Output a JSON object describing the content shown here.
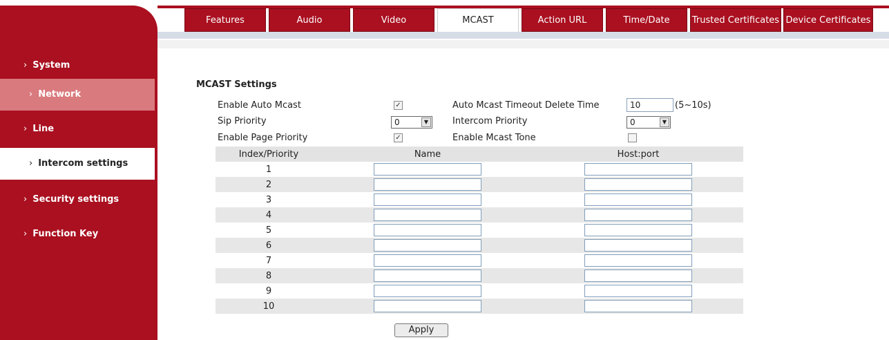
{
  "sidebar": {
    "items": [
      {
        "label": "System"
      },
      {
        "label": "Network"
      },
      {
        "label": "Line"
      },
      {
        "label": "Intercom settings"
      },
      {
        "label": "Security settings"
      },
      {
        "label": "Function Key"
      }
    ],
    "chevron": "›"
  },
  "tabs": [
    {
      "label": "Features"
    },
    {
      "label": "Audio"
    },
    {
      "label": "Video"
    },
    {
      "label": "MCAST"
    },
    {
      "label": "Action URL"
    },
    {
      "label": "Time/Date"
    },
    {
      "label": "Trusted Certificates"
    },
    {
      "label": "Device Certificates"
    }
  ],
  "mcast": {
    "title": "MCAST Settings",
    "enable_auto_mcast": {
      "label": "Enable Auto Mcast",
      "checked": true
    },
    "auto_timeout": {
      "label": "Auto Mcast Timeout Delete Time",
      "value": "10",
      "hint": "(5~10s)"
    },
    "sip_priority": {
      "label": "Sip Priority",
      "value": "0"
    },
    "intercom_priority": {
      "label": "Intercom Priority",
      "value": "0"
    },
    "enable_page_priority": {
      "label": "Enable Page Priority",
      "checked": true
    },
    "enable_mcast_tone": {
      "label": "Enable Mcast Tone",
      "checked": false
    }
  },
  "table": {
    "headers": [
      "Index/Priority",
      "Name",
      "Host:port"
    ],
    "rows": [
      "1",
      "2",
      "3",
      "4",
      "5",
      "6",
      "7",
      "8",
      "9",
      "10"
    ]
  },
  "apply_label": "Apply",
  "check_mark": "✓",
  "dropdown_arrow": "▼",
  "colors": {
    "brand_red": "#aa1020",
    "nav_highlight": "#d97a7e",
    "table_stripe": "#e7e7e7"
  }
}
